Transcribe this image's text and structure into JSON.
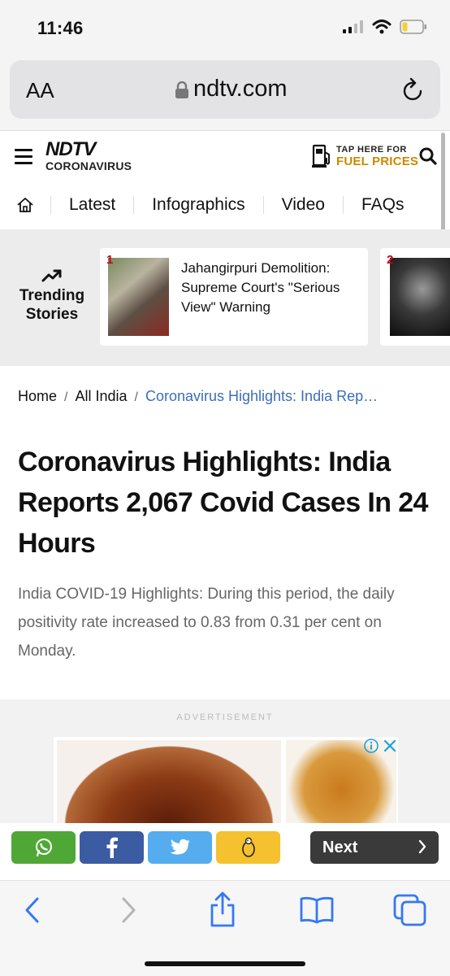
{
  "status_bar": {
    "time": "11:46"
  },
  "url_bar": {
    "text_size_label": "AA",
    "domain": "ndtv.com"
  },
  "header": {
    "logo_brand": "NDTV",
    "logo_sub": "CORONAVIRUS",
    "fuel_line1": "TAP HERE FOR",
    "fuel_line2": "FUEL PRICES"
  },
  "nav": {
    "items": [
      "Latest",
      "Infographics",
      "Video",
      "FAQs"
    ]
  },
  "trending": {
    "label": "Trending Stories",
    "cards": [
      {
        "rank": "1",
        "title": "Jahangirpuri Demolition: Supreme Court's \"Serious View\" Warning"
      },
      {
        "rank": "2",
        "title": ""
      }
    ]
  },
  "breadcrumb": {
    "home": "Home",
    "section": "All India",
    "current": "Coronavirus Highlights: India Rep…"
  },
  "article": {
    "headline": "Coronavirus Highlights: India Reports 2,067 Covid Cases In 24 Hours",
    "summary": "India COVID-19 Highlights: During this period, the daily positivity rate increased to 0.83 from 0.31 per cent on Monday."
  },
  "ad": {
    "label": "ADVERTISEMENT"
  },
  "share_bar": {
    "next_label": "Next"
  },
  "colors": {
    "whatsapp": "#4fa836",
    "facebook": "#3b5ba3",
    "twitter": "#55acee",
    "koo": "#f5c12e",
    "link": "#3b6fb6",
    "accent_red": "#d0021b",
    "fuel_gold": "#c98a00",
    "safari_blue": "#3478f6"
  }
}
